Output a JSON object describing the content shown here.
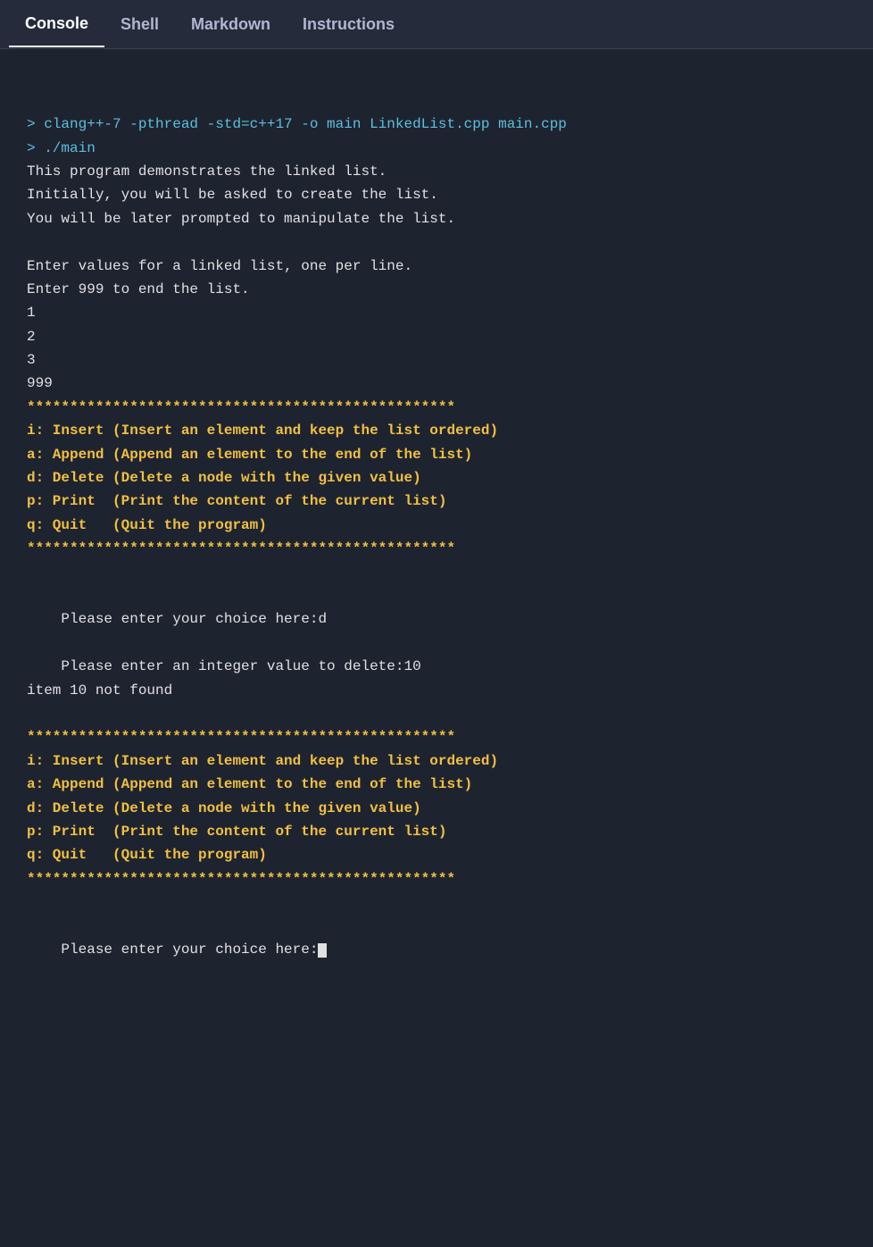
{
  "tabs": [
    {
      "label": "Console",
      "active": true
    },
    {
      "label": "Shell",
      "active": false
    },
    {
      "label": "Markdown",
      "active": false
    },
    {
      "label": "Instructions",
      "active": false
    }
  ],
  "console": {
    "lines": [
      {
        "type": "prompt",
        "text": "> clang++-7 -pthread -std=c++17 -o main LinkedList.cpp main.cpp"
      },
      {
        "type": "prompt",
        "text": "> ./main"
      },
      {
        "type": "normal",
        "text": "This program demonstrates the linked list."
      },
      {
        "type": "normal",
        "text": "Initially, you will be asked to create the list."
      },
      {
        "type": "normal",
        "text": "You will be later prompted to manipulate the list."
      },
      {
        "type": "blank"
      },
      {
        "type": "normal",
        "text": "Enter values for a linked list, one per line."
      },
      {
        "type": "normal",
        "text": "Enter 999 to end the list."
      },
      {
        "type": "normal",
        "text": "1"
      },
      {
        "type": "normal",
        "text": "2"
      },
      {
        "type": "normal",
        "text": "3"
      },
      {
        "type": "normal",
        "text": "999"
      },
      {
        "type": "yellow",
        "text": "**************************************************"
      },
      {
        "type": "yellow",
        "text": "i: Insert (Insert an element and keep the list ordered)"
      },
      {
        "type": "yellow",
        "text": "a: Append (Append an element to the end of the list)"
      },
      {
        "type": "yellow",
        "text": "d: Delete (Delete a node with the given value)"
      },
      {
        "type": "yellow",
        "text": "p: Print  (Print the content of the current list)"
      },
      {
        "type": "yellow",
        "text": "q: Quit   (Quit the program)"
      },
      {
        "type": "yellow",
        "text": "**************************************************"
      },
      {
        "type": "blank"
      },
      {
        "type": "blank"
      },
      {
        "type": "normal",
        "text": "    Please enter your choice here:d"
      },
      {
        "type": "blank"
      },
      {
        "type": "normal",
        "text": "    Please enter an integer value to delete:10"
      },
      {
        "type": "normal",
        "text": "item 10 not found"
      },
      {
        "type": "blank"
      },
      {
        "type": "yellow",
        "text": "**************************************************"
      },
      {
        "type": "yellow",
        "text": "i: Insert (Insert an element and keep the list ordered)"
      },
      {
        "type": "yellow",
        "text": "a: Append (Append an element to the end of the list)"
      },
      {
        "type": "yellow",
        "text": "d: Delete (Delete a node with the given value)"
      },
      {
        "type": "yellow",
        "text": "p: Print  (Print the content of the current list)"
      },
      {
        "type": "yellow",
        "text": "q: Quit   (Quit the program)"
      },
      {
        "type": "yellow",
        "text": "**************************************************"
      },
      {
        "type": "blank"
      },
      {
        "type": "blank"
      },
      {
        "type": "cursor",
        "text": "    Please enter your choice here:"
      }
    ]
  }
}
